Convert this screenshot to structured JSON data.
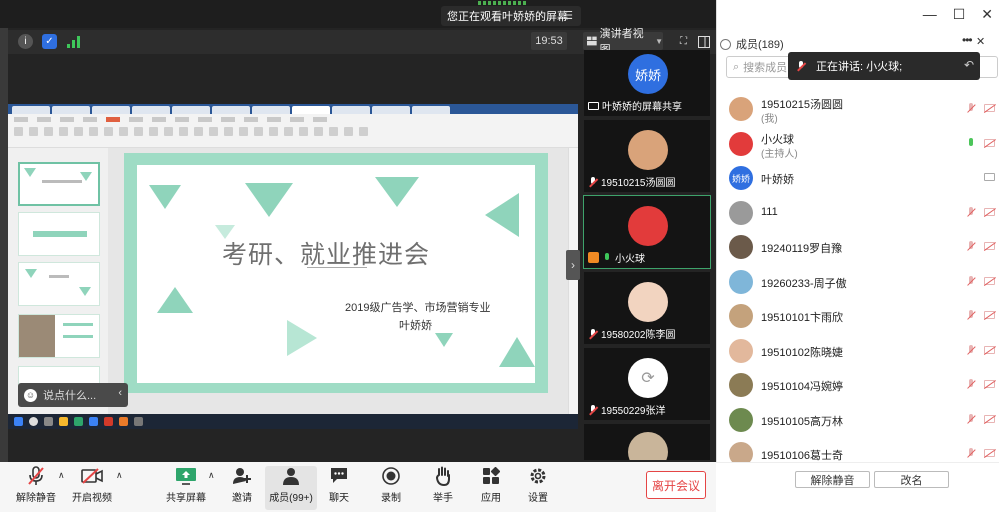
{
  "banner": {
    "text": "您正在观看叶娇娇的屏幕"
  },
  "top_toolbar": {
    "time": "19:53",
    "view_label": "演讲者视图"
  },
  "slide": {
    "title": "考研、就业推进会",
    "subtitle": "2019级广告学、市场营销专业",
    "author": "叶娇娇"
  },
  "chat": {
    "placeholder": "说点什么..."
  },
  "video_tiles": [
    {
      "name": "叶娇娇的屏幕共享",
      "avatar_text": "娇娇",
      "mic": "share",
      "color": "#2f6fe0"
    },
    {
      "name": "19510215汤圆圆",
      "mic": "off",
      "color": "#d9a37a"
    },
    {
      "name": "小火球",
      "mic": "on",
      "color": "#e23b3b",
      "active": true
    },
    {
      "name": "19580202陈李圆",
      "mic": "off",
      "color": "#f2d4c0"
    },
    {
      "name": "19550229张洋",
      "mic": "off",
      "color": "#ffffff"
    }
  ],
  "bottom_toolbar": {
    "items": [
      {
        "label": "解除静音",
        "icon": "mic-muted-icon"
      },
      {
        "label": "开启视频",
        "icon": "video-off-icon"
      },
      {
        "label": "共享屏幕",
        "icon": "share-screen-icon"
      },
      {
        "label": "邀请",
        "icon": "invite-icon"
      },
      {
        "label": "成员(99+)",
        "icon": "members-icon"
      },
      {
        "label": "聊天",
        "icon": "chat-icon"
      },
      {
        "label": "录制",
        "icon": "record-icon"
      },
      {
        "label": "举手",
        "icon": "raise-hand-icon"
      },
      {
        "label": "应用",
        "icon": "apps-icon"
      },
      {
        "label": "设置",
        "icon": "settings-icon"
      }
    ],
    "leave_label": "离开会议"
  },
  "panel": {
    "title": "成员(189)",
    "search_placeholder": "搜索成员",
    "speaking_label": "正在讲话: 小火球;",
    "members": [
      {
        "name": "19510215汤圆圆",
        "role": "(我)",
        "mic": "off",
        "cam": "off",
        "color": "#d9a37a"
      },
      {
        "name": "小火球",
        "role": "(主持人)",
        "mic": "on",
        "cam": "off",
        "color": "#e23b3b"
      },
      {
        "name": "叶娇娇",
        "role": "",
        "mic": "none",
        "cam": "screen",
        "color": "#2f6fe0",
        "avatar_text": "娇娇"
      },
      {
        "name": "111",
        "role": "",
        "mic": "off",
        "cam": "off",
        "color": "#9a9a9a"
      },
      {
        "name": "19240119罗自豫",
        "role": "",
        "mic": "off",
        "cam": "off",
        "color": "#6b5a4a"
      },
      {
        "name": "19260233-周子傲",
        "role": "",
        "mic": "off",
        "cam": "off",
        "color": "#7fb6d9"
      },
      {
        "name": "19510101卞雨欣",
        "role": "",
        "mic": "off",
        "cam": "off",
        "color": "#c4a27c"
      },
      {
        "name": "19510102陈晓婕",
        "role": "",
        "mic": "off",
        "cam": "off",
        "color": "#e2b89c"
      },
      {
        "name": "19510104冯婉婷",
        "role": "",
        "mic": "off",
        "cam": "off",
        "color": "#8b7b55"
      },
      {
        "name": "19510105高万林",
        "role": "",
        "mic": "off",
        "cam": "off",
        "color": "#6d8a4f"
      },
      {
        "name": "19510106葛士奇",
        "role": "",
        "mic": "off",
        "cam": "off",
        "color": "#c9a88a"
      }
    ],
    "unmute_all_label": "解除静音",
    "rename_label": "改名"
  }
}
